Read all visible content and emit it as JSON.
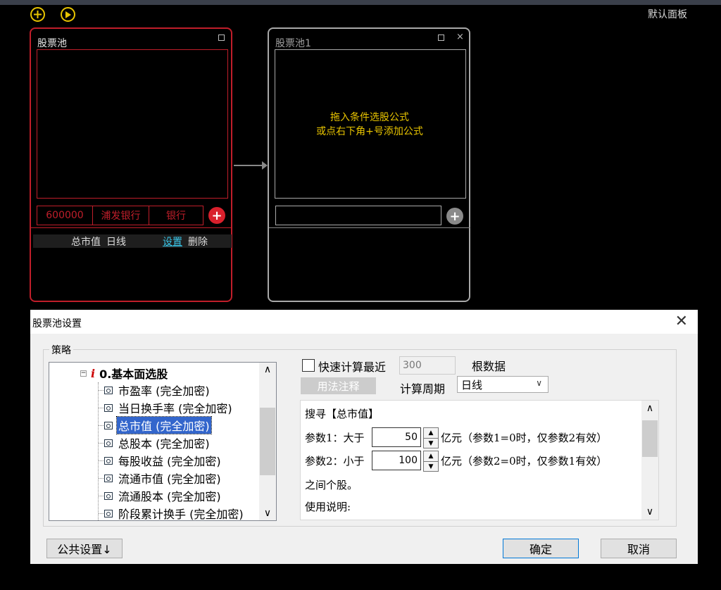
{
  "toolbar": {
    "add_icon": "plus-circle-icon",
    "play_icon": "play-circle-icon",
    "panel_name": "默认面板"
  },
  "pool1": {
    "title": "股票池",
    "stock": {
      "code": "600000",
      "name": "浦发银行",
      "industry": "银行"
    },
    "condition": {
      "name": "总市值",
      "period": "日线",
      "settings_link": "设置",
      "delete_label": "删除"
    }
  },
  "pool2": {
    "title": "股票池1",
    "hint_line1": "拖入条件选股公式",
    "hint_line2": "或点右下角+号添加公式"
  },
  "dialog": {
    "title": "股票池设置",
    "strategy_label": "策略",
    "tree": {
      "root": "0.基本面选股",
      "items": [
        "市盈率 (完全加密)",
        "当日换手率 (完全加密)",
        "总市值 (完全加密)",
        "总股本 (完全加密)",
        "每股收益 (完全加密)",
        "流通市值 (完全加密)",
        "流通股本 (完全加密)",
        "阶段累计换手 (完全加密)"
      ],
      "selected_index": 2
    },
    "quick_calc_label": "快速计算最近",
    "quick_calc_value": "300",
    "quick_calc_unit": "根数据",
    "usage_button": "用法注释",
    "period_label": "计算周期",
    "period_value": "日线",
    "desc": {
      "heading": "搜寻【总市值】",
      "param1_prefix": "参数1：大于",
      "param1_value": "50",
      "param1_suffix": "亿元（参数1=0时，仅参数2有效）",
      "param2_prefix": "参数2：小于",
      "param2_value": "100",
      "param2_suffix": "亿元（参数2=0时，仅参数1有效）",
      "line3": "之间个股。",
      "line4": "使用说明:"
    },
    "public_settings_button": "公共设置↓",
    "ok_button": "确定",
    "cancel_button": "取消"
  },
  "colors": {
    "accent_red": "#c01e2a",
    "accent_yellow": "#e8c400",
    "selection_blue": "#3366cc"
  }
}
